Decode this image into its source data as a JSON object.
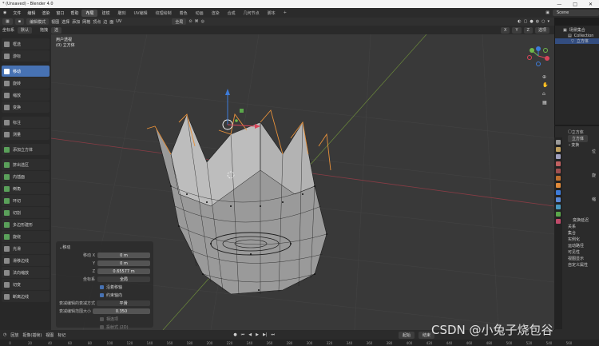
{
  "window": {
    "title": "* (Unsaved) - Blender 4.0",
    "minimize": "—",
    "maximize": "□",
    "close": "✕"
  },
  "menu": {
    "items": [
      "文件",
      "编辑",
      "渲染",
      "窗口",
      "帮助"
    ],
    "workspaces": [
      "布局",
      "建模",
      "雕刻",
      "UV编辑",
      "纹理绘制",
      "着色",
      "动画",
      "渲染",
      "合成",
      "几何节点",
      "脚本"
    ],
    "active_workspace": "布局",
    "scene": "Scene"
  },
  "viewport_header": {
    "mode": "编辑模式",
    "items": [
      "视图",
      "选择",
      "添加",
      "网格",
      "顶点",
      "边",
      "面",
      "UV"
    ],
    "transform_orientation": "全局",
    "right_label": "选项"
  },
  "viewport_header2": {
    "coord": "坐标系",
    "default": "默认",
    "drag": "拖拽",
    "select": "选"
  },
  "viewport_label": {
    "line1": "用户透视",
    "line2": "(0) 立方体"
  },
  "toolbar": {
    "tools": [
      "框选",
      "游标",
      "移动",
      "旋转",
      "缩放",
      "变换",
      "标注",
      "测量",
      "添加立方体",
      "挤出选区",
      "内插面",
      "倒角",
      "环切",
      "切割",
      "多边形建形",
      "旋绕",
      "光滑",
      "滑移边线",
      "法向缩放",
      "切变",
      "断离边线"
    ],
    "active": "移动"
  },
  "operator_panel": {
    "title": "移动",
    "move_x_label": "移动 X",
    "move_x": "0 m",
    "y_label": "Y",
    "move_y": "0 m",
    "z_label": "Z",
    "move_z": "0.65577 m",
    "orientation_label": "坐标系",
    "orientation": "全局",
    "snap_x": "沿着移轴",
    "snap_y": "约束轴向",
    "proportional_label": "衰减编辑的衰减方式",
    "proportional": "平滑",
    "prop_size_label": "衰减编辑范围大小",
    "prop_size": "0.350",
    "opt_a": "相连项",
    "opt_b": "投射式 (2D)"
  },
  "outliner": {
    "rows": [
      "场景集合",
      "Collection",
      "立方体"
    ]
  },
  "properties": {
    "object_name": "立方体",
    "data_name": "立方体",
    "sections": [
      "变换",
      "变换延迟",
      "关系",
      "集合",
      "实例化",
      "运动路径",
      "可见性",
      "视图显示",
      "自定义属性"
    ],
    "labels": [
      "位",
      "旋",
      "缩"
    ]
  },
  "timeline": {
    "items": [
      "回放",
      "抠像(插帧)",
      "视图",
      "标记"
    ],
    "frame_start_label": "起始",
    "frame_end_label": "结束",
    "frames": [
      "0",
      "20",
      "40",
      "60",
      "80",
      "100",
      "120",
      "140",
      "160",
      "180",
      "200",
      "220",
      "240",
      "260",
      "280",
      "300",
      "320",
      "340",
      "360",
      "380",
      "400",
      "420",
      "440",
      "460",
      "480",
      "500",
      "520",
      "540",
      "560"
    ]
  },
  "watermark": "CSDN @小兔子烧包谷"
}
